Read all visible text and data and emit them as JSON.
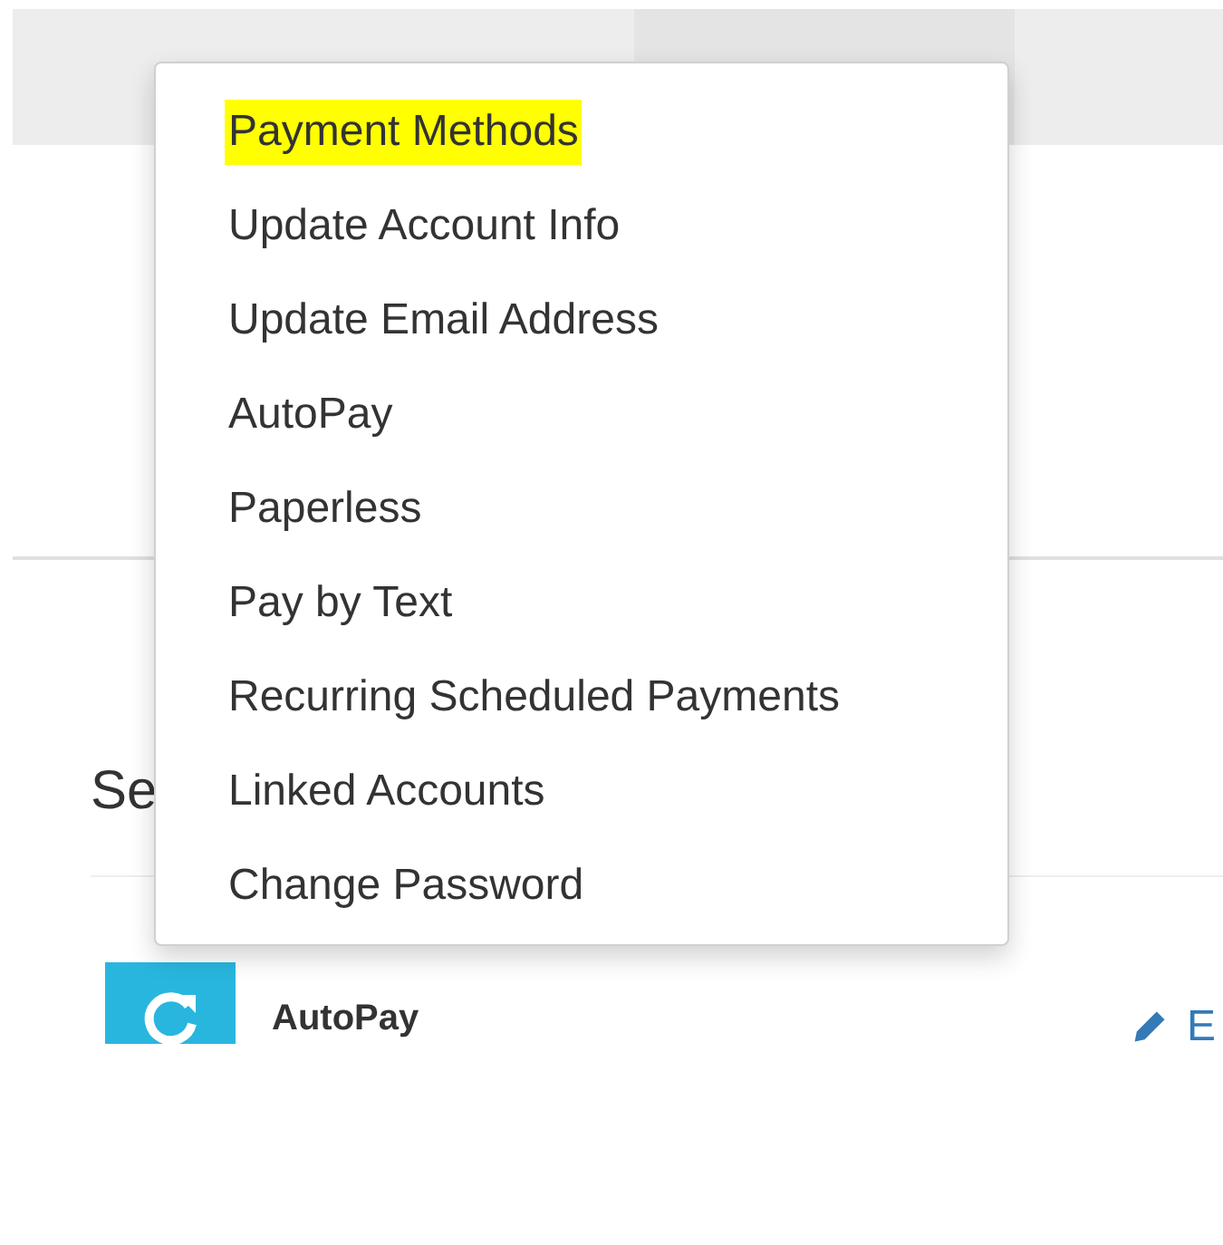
{
  "top_bar": {
    "tabs": [
      {
        "selected": false
      },
      {
        "selected": true
      }
    ]
  },
  "section": {
    "heading": "Se",
    "row": {
      "title": "AutoPay",
      "action": "E"
    }
  },
  "dropdown_menu": {
    "items": [
      {
        "label": "Payment Methods",
        "highlighted": true
      },
      {
        "label": "Update Account Info",
        "highlighted": false
      },
      {
        "label": "Update Email Address",
        "highlighted": false
      },
      {
        "label": "AutoPay",
        "highlighted": false
      },
      {
        "label": "Paperless",
        "highlighted": false
      },
      {
        "label": "Pay by Text",
        "highlighted": false
      },
      {
        "label": "Recurring Scheduled Payments",
        "highlighted": false
      },
      {
        "label": "Linked Accounts",
        "highlighted": false
      },
      {
        "label": "Change Password",
        "highlighted": false
      }
    ]
  }
}
